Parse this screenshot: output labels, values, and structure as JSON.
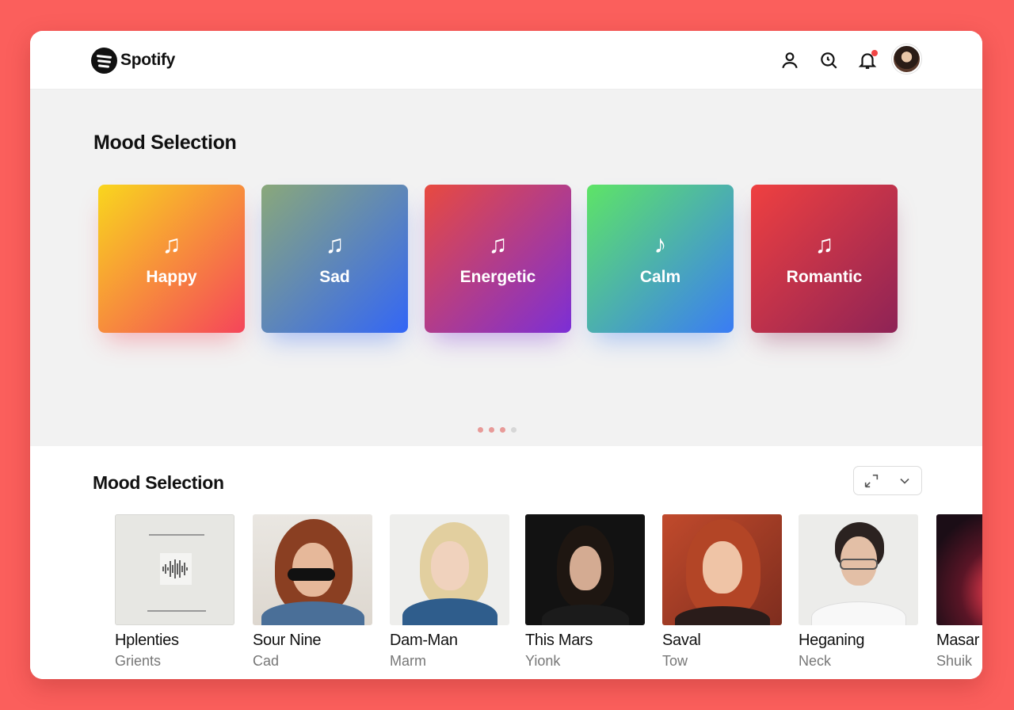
{
  "app": {
    "logo_text": "Spotify"
  },
  "header": {
    "icons": [
      "user-icon",
      "search-icon",
      "notification-icon"
    ],
    "accent": "#f24646"
  },
  "hero": {
    "title": "Mood Selection",
    "moods": [
      {
        "label": "Happy",
        "note": "♫",
        "colors": [
          "#f9d61e",
          "#f5455a"
        ]
      },
      {
        "label": "Sad",
        "note": "♫",
        "colors": [
          "#8aa87a",
          "#3366f6"
        ]
      },
      {
        "label": "Energetic",
        "note": "♫",
        "colors": [
          "#e84a3f",
          "#7c2fd6"
        ]
      },
      {
        "label": "Calm",
        "note": "♪",
        "colors": [
          "#5ee466",
          "#3a7cf5"
        ]
      },
      {
        "label": "Romantic",
        "note": "♫",
        "colors": [
          "#ef4040",
          "#8e2356"
        ]
      }
    ],
    "pager": {
      "pages": 4,
      "active": 1
    }
  },
  "playlists": {
    "title": "Mood Selection",
    "items": [
      {
        "name": "Hplenties",
        "artist": "Grients",
        "cover": "waveform"
      },
      {
        "name": "Sour Nine",
        "artist": "Cad",
        "cover": "portrait-sunglasses"
      },
      {
        "name": "Dam-Man",
        "artist": "Marm",
        "cover": "portrait-blonde"
      },
      {
        "name": "This Mars",
        "artist": "Yionk",
        "cover": "portrait-dark"
      },
      {
        "name": "Saval",
        "artist": "Tow",
        "cover": "portrait-redhead"
      },
      {
        "name": "Heganing",
        "artist": "Neck",
        "cover": "portrait-glasses"
      },
      {
        "name": "Masar",
        "artist": "Shuik",
        "cover": "abstract-red"
      }
    ]
  }
}
